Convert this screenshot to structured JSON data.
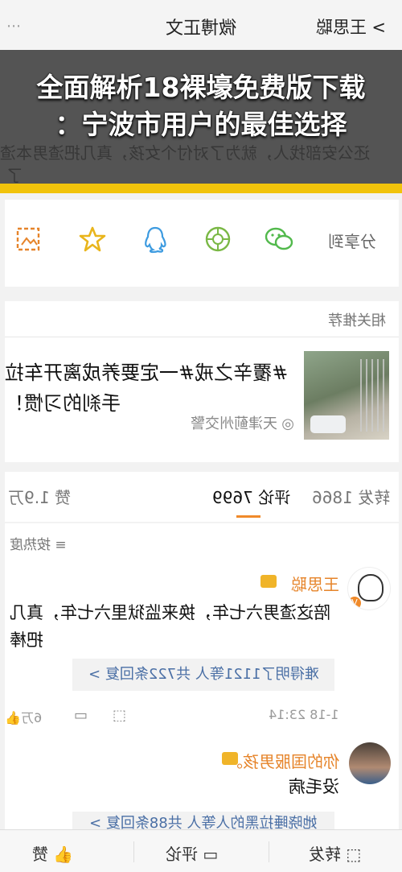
{
  "topbar": {
    "title": "微博正文",
    "back_label": "王思聪",
    "back_glyph": "<"
  },
  "headline": {
    "line1": "全面解析18裸壕免费版下载",
    "line2": "：宁波市用户的最佳选择"
  },
  "overlay_bg_text": {
    "line1": "还公安部找人，就为了对付个女孩，真几把渣男本渣",
    "line2": "了"
  },
  "share": {
    "label": "分享到",
    "icons": [
      "weixin-icon",
      "moments-icon",
      "qq-icon",
      "favorite-star-icon",
      "save-image-icon"
    ]
  },
  "related": {
    "header": "相关推荐",
    "title": "#覆辛之戒#一定要养成离开车拉手刹的习惯！",
    "source": "天津蓟州交警"
  },
  "tabs": {
    "repost": "转发 1866",
    "comment": "评论 7699",
    "like": "赞 1.9万"
  },
  "comments": {
    "sort_label": "按热度",
    "list": [
      {
        "name": "王思聪",
        "text": "陪这渣男六七年，换来监狱里六七年，真几把棒",
        "reply_summary": "难得明了1121等人 共722条回复 >",
        "time": "1-18 23:14",
        "likes": "6万"
      },
      {
        "name": "你的国服男孩。",
        "text": "没毛病",
        "reply_summary": "她晓睡拉黑的人等人 共88条回复 >"
      }
    ]
  },
  "bottombar": {
    "repost": "转发",
    "comment": "评论",
    "like": "赞"
  },
  "colors": {
    "accent_orange": "#f08a2a",
    "yellow_bar": "#f1c30b",
    "link_blue": "#4a6fa5"
  }
}
